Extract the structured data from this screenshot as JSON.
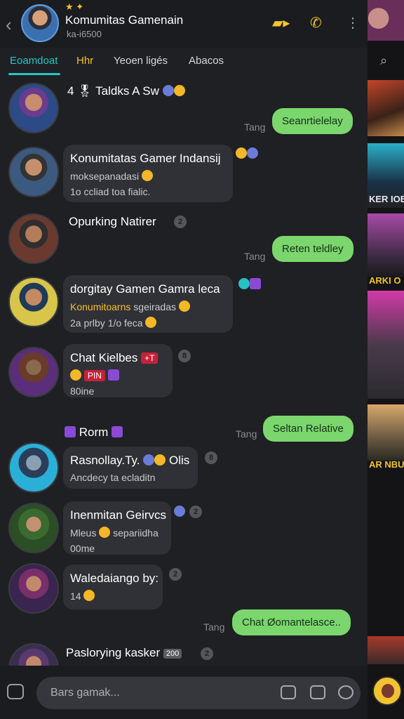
{
  "header": {
    "back_icon": "chevron-left-icon",
    "stars": "★ ✦",
    "title": "Komumitas Gamenain",
    "subtitle": "ka-i6500",
    "icons": [
      "folder-icon",
      "phone-icon",
      "more-vertical-icon"
    ]
  },
  "tabs": [
    {
      "label": "Eoamdoat",
      "active": true
    },
    {
      "label": "Hhr",
      "active": false
    },
    {
      "label": "Yeoen ligés",
      "active": false
    },
    {
      "label": "Abacos",
      "active": false
    }
  ],
  "messages": [
    {
      "type": "plain",
      "name": "4 🎖 Taldks A Sw"
    },
    {
      "type": "out",
      "text": "Seanrtielelay",
      "time": "Tang"
    },
    {
      "type": "in",
      "name": "Konumitatas Gamer Indansij",
      "lines": [
        "moksepanadasi",
        "1o ccliad toa fialic."
      ]
    },
    {
      "type": "plain",
      "name": "Opurking Natirer",
      "badge": "2"
    },
    {
      "type": "out",
      "text": "Reten teldley",
      "time": "Tang"
    },
    {
      "type": "in",
      "name": "dorgitay Gamen Gamra leca",
      "lines": [
        "Konumitoarns",
        "sgeiradas",
        "2a prlby 1/o feca"
      ]
    },
    {
      "type": "in",
      "name": "Chat Kielbes",
      "lines": [
        "PIN",
        "80ine"
      ],
      "badge": "8"
    },
    {
      "type": "plain",
      "name": "Rorm"
    },
    {
      "type": "out",
      "text": "Seltan Relative",
      "time": "Tang"
    },
    {
      "type": "in",
      "name": "Rasnollay.Ty.",
      "name_suffix": "Olis",
      "lines": [
        "Ancdecy ta ecladitn"
      ],
      "badge": "8"
    },
    {
      "type": "in",
      "name": "Inenmitan Geirvcs",
      "lines": [
        "Mleus",
        "separiidha",
        "00me"
      ],
      "badge": "2"
    },
    {
      "type": "in",
      "name": "Waledaiango by:",
      "lines": [
        "14"
      ],
      "badge": "2"
    },
    {
      "type": "out",
      "text": "Chat Øomantelasce..",
      "time": "Tang"
    },
    {
      "type": "plain",
      "name": "Paslorying kasker",
      "tag": "200",
      "badge": "2"
    }
  ],
  "strip": {
    "labels": [
      "KER IOE",
      "ARKI O",
      "AR NBU"
    ]
  },
  "composer": {
    "placeholder": "Bars gamak...",
    "icons": [
      "camera-icon",
      "sticker-icon",
      "emoji-icon"
    ]
  },
  "colors": {
    "accent": "#27c6c6",
    "gold": "#f2c230",
    "outgoing_bubble": "#7bd66e",
    "incoming_bubble": "#303136",
    "background": "#1f2023"
  }
}
